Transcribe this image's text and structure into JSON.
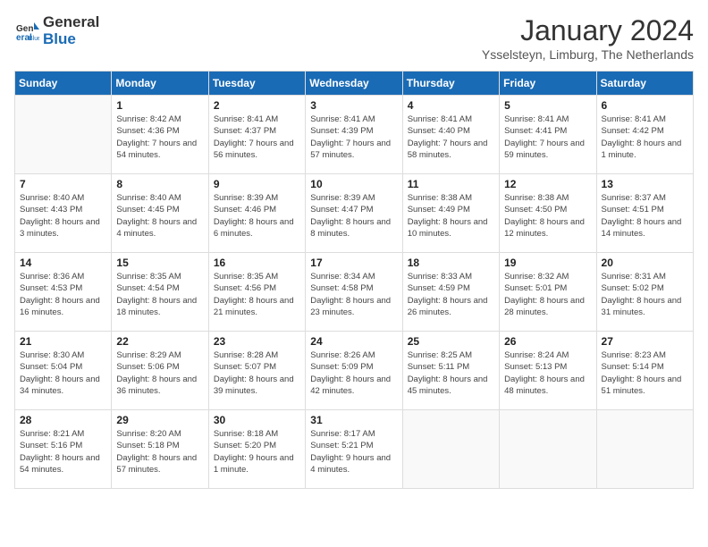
{
  "header": {
    "logo_line1": "General",
    "logo_line2": "Blue",
    "month": "January 2024",
    "location": "Ysselsteyn, Limburg, The Netherlands"
  },
  "weekdays": [
    "Sunday",
    "Monday",
    "Tuesday",
    "Wednesday",
    "Thursday",
    "Friday",
    "Saturday"
  ],
  "weeks": [
    [
      {
        "day": "",
        "sunrise": "",
        "sunset": "",
        "daylight": ""
      },
      {
        "day": "1",
        "sunrise": "Sunrise: 8:42 AM",
        "sunset": "Sunset: 4:36 PM",
        "daylight": "Daylight: 7 hours and 54 minutes."
      },
      {
        "day": "2",
        "sunrise": "Sunrise: 8:41 AM",
        "sunset": "Sunset: 4:37 PM",
        "daylight": "Daylight: 7 hours and 56 minutes."
      },
      {
        "day": "3",
        "sunrise": "Sunrise: 8:41 AM",
        "sunset": "Sunset: 4:39 PM",
        "daylight": "Daylight: 7 hours and 57 minutes."
      },
      {
        "day": "4",
        "sunrise": "Sunrise: 8:41 AM",
        "sunset": "Sunset: 4:40 PM",
        "daylight": "Daylight: 7 hours and 58 minutes."
      },
      {
        "day": "5",
        "sunrise": "Sunrise: 8:41 AM",
        "sunset": "Sunset: 4:41 PM",
        "daylight": "Daylight: 7 hours and 59 minutes."
      },
      {
        "day": "6",
        "sunrise": "Sunrise: 8:41 AM",
        "sunset": "Sunset: 4:42 PM",
        "daylight": "Daylight: 8 hours and 1 minute."
      }
    ],
    [
      {
        "day": "7",
        "sunrise": "Sunrise: 8:40 AM",
        "sunset": "Sunset: 4:43 PM",
        "daylight": "Daylight: 8 hours and 3 minutes."
      },
      {
        "day": "8",
        "sunrise": "Sunrise: 8:40 AM",
        "sunset": "Sunset: 4:45 PM",
        "daylight": "Daylight: 8 hours and 4 minutes."
      },
      {
        "day": "9",
        "sunrise": "Sunrise: 8:39 AM",
        "sunset": "Sunset: 4:46 PM",
        "daylight": "Daylight: 8 hours and 6 minutes."
      },
      {
        "day": "10",
        "sunrise": "Sunrise: 8:39 AM",
        "sunset": "Sunset: 4:47 PM",
        "daylight": "Daylight: 8 hours and 8 minutes."
      },
      {
        "day": "11",
        "sunrise": "Sunrise: 8:38 AM",
        "sunset": "Sunset: 4:49 PM",
        "daylight": "Daylight: 8 hours and 10 minutes."
      },
      {
        "day": "12",
        "sunrise": "Sunrise: 8:38 AM",
        "sunset": "Sunset: 4:50 PM",
        "daylight": "Daylight: 8 hours and 12 minutes."
      },
      {
        "day": "13",
        "sunrise": "Sunrise: 8:37 AM",
        "sunset": "Sunset: 4:51 PM",
        "daylight": "Daylight: 8 hours and 14 minutes."
      }
    ],
    [
      {
        "day": "14",
        "sunrise": "Sunrise: 8:36 AM",
        "sunset": "Sunset: 4:53 PM",
        "daylight": "Daylight: 8 hours and 16 minutes."
      },
      {
        "day": "15",
        "sunrise": "Sunrise: 8:35 AM",
        "sunset": "Sunset: 4:54 PM",
        "daylight": "Daylight: 8 hours and 18 minutes."
      },
      {
        "day": "16",
        "sunrise": "Sunrise: 8:35 AM",
        "sunset": "Sunset: 4:56 PM",
        "daylight": "Daylight: 8 hours and 21 minutes."
      },
      {
        "day": "17",
        "sunrise": "Sunrise: 8:34 AM",
        "sunset": "Sunset: 4:58 PM",
        "daylight": "Daylight: 8 hours and 23 minutes."
      },
      {
        "day": "18",
        "sunrise": "Sunrise: 8:33 AM",
        "sunset": "Sunset: 4:59 PM",
        "daylight": "Daylight: 8 hours and 26 minutes."
      },
      {
        "day": "19",
        "sunrise": "Sunrise: 8:32 AM",
        "sunset": "Sunset: 5:01 PM",
        "daylight": "Daylight: 8 hours and 28 minutes."
      },
      {
        "day": "20",
        "sunrise": "Sunrise: 8:31 AM",
        "sunset": "Sunset: 5:02 PM",
        "daylight": "Daylight: 8 hours and 31 minutes."
      }
    ],
    [
      {
        "day": "21",
        "sunrise": "Sunrise: 8:30 AM",
        "sunset": "Sunset: 5:04 PM",
        "daylight": "Daylight: 8 hours and 34 minutes."
      },
      {
        "day": "22",
        "sunrise": "Sunrise: 8:29 AM",
        "sunset": "Sunset: 5:06 PM",
        "daylight": "Daylight: 8 hours and 36 minutes."
      },
      {
        "day": "23",
        "sunrise": "Sunrise: 8:28 AM",
        "sunset": "Sunset: 5:07 PM",
        "daylight": "Daylight: 8 hours and 39 minutes."
      },
      {
        "day": "24",
        "sunrise": "Sunrise: 8:26 AM",
        "sunset": "Sunset: 5:09 PM",
        "daylight": "Daylight: 8 hours and 42 minutes."
      },
      {
        "day": "25",
        "sunrise": "Sunrise: 8:25 AM",
        "sunset": "Sunset: 5:11 PM",
        "daylight": "Daylight: 8 hours and 45 minutes."
      },
      {
        "day": "26",
        "sunrise": "Sunrise: 8:24 AM",
        "sunset": "Sunset: 5:13 PM",
        "daylight": "Daylight: 8 hours and 48 minutes."
      },
      {
        "day": "27",
        "sunrise": "Sunrise: 8:23 AM",
        "sunset": "Sunset: 5:14 PM",
        "daylight": "Daylight: 8 hours and 51 minutes."
      }
    ],
    [
      {
        "day": "28",
        "sunrise": "Sunrise: 8:21 AM",
        "sunset": "Sunset: 5:16 PM",
        "daylight": "Daylight: 8 hours and 54 minutes."
      },
      {
        "day": "29",
        "sunrise": "Sunrise: 8:20 AM",
        "sunset": "Sunset: 5:18 PM",
        "daylight": "Daylight: 8 hours and 57 minutes."
      },
      {
        "day": "30",
        "sunrise": "Sunrise: 8:18 AM",
        "sunset": "Sunset: 5:20 PM",
        "daylight": "Daylight: 9 hours and 1 minute."
      },
      {
        "day": "31",
        "sunrise": "Sunrise: 8:17 AM",
        "sunset": "Sunset: 5:21 PM",
        "daylight": "Daylight: 9 hours and 4 minutes."
      },
      {
        "day": "",
        "sunrise": "",
        "sunset": "",
        "daylight": ""
      },
      {
        "day": "",
        "sunrise": "",
        "sunset": "",
        "daylight": ""
      },
      {
        "day": "",
        "sunrise": "",
        "sunset": "",
        "daylight": ""
      }
    ]
  ]
}
